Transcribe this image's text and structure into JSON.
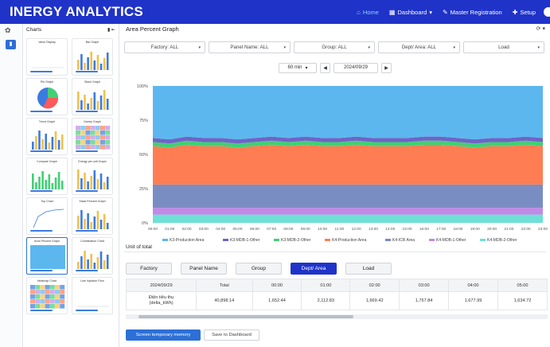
{
  "app": {
    "brand": "INERGY ANALYTICS",
    "nav": [
      {
        "label": "Home",
        "icon": "home-icon"
      },
      {
        "label": "Dashboard",
        "icon": "dashboard-icon"
      },
      {
        "label": "Master Registration",
        "icon": "edit-icon"
      },
      {
        "label": "Setup",
        "icon": "wrench-icon"
      }
    ]
  },
  "sidebar": {
    "title": "Charts",
    "thumbs": [
      {
        "title": "Value Display"
      },
      {
        "title": "Bar Graph"
      },
      {
        "title": "Pie Graph"
      },
      {
        "title": "Stack Graph"
      },
      {
        "title": "Trend Graph"
      },
      {
        "title": "Gantry Graph"
      },
      {
        "title": "Compare Graph"
      },
      {
        "title": "Energy per unit Graph"
      },
      {
        "title": "Top Chart"
      },
      {
        "title": "Stack Percent Graph"
      },
      {
        "title": "Area Percent Graph"
      },
      {
        "title": "Combination Chart"
      },
      {
        "title": "Heatmap Chart"
      },
      {
        "title": "Line Injection Flow"
      }
    ]
  },
  "main": {
    "title": "Area Percent Graph",
    "filters": [
      {
        "label": "Factory: ALL"
      },
      {
        "label": "Panel Name: ALL"
      },
      {
        "label": "Group: ALL"
      },
      {
        "label": "Dept/ Area: ALL"
      },
      {
        "label": "Load"
      }
    ],
    "interval": "60 min",
    "date": "2024/09/29",
    "unit_label": "Unit of total",
    "tabs": [
      "Factory",
      "Panel Name",
      "Group",
      "Dept/ Area",
      "Load"
    ],
    "active_tab": "Dept/ Area",
    "table": {
      "headers": [
        "2024/09/29",
        "Total",
        "00:00",
        "01:00",
        "02:00",
        "03:00",
        "04:00",
        "05:00"
      ],
      "row_label_line1": "Điện tiêu thụ",
      "row_label_line2": "(delta_kWh)",
      "values": [
        "40,898.14",
        "1,652.44",
        "2,112.83",
        "1,669.42",
        "1,767.84",
        "1,677.99",
        "1,634.72"
      ]
    },
    "buttons": {
      "primary": "Screen temporary memory",
      "secondary": "Save to Dashboard"
    }
  },
  "chart_data": {
    "type": "area",
    "stacked_percent": true,
    "x": [
      "00:00",
      "01:00",
      "02:00",
      "03:00",
      "04:00",
      "05:00",
      "06:00",
      "07:00",
      "08:00",
      "09:00",
      "10:00",
      "11:00",
      "12:00",
      "13:00",
      "14:00",
      "15:00",
      "16:00",
      "17:00",
      "18:00",
      "19:00",
      "20:00",
      "21:00",
      "22:00",
      "23:00"
    ],
    "ylim": [
      0,
      100
    ],
    "yticks": [
      "0%",
      "25%",
      "50%",
      "75%",
      "100%"
    ],
    "legend_position": "bottom",
    "grid": true,
    "series": [
      {
        "name": "K3-Production Area",
        "color": "#5cb7ef",
        "values": [
          38,
          39,
          37,
          38,
          38,
          39,
          38,
          37,
          38,
          37,
          38,
          38,
          37,
          38,
          38,
          38,
          37,
          37,
          38,
          39,
          38,
          38,
          37,
          38
        ]
      },
      {
        "name": "K3-MDB-1-Other",
        "color": "#6f64c6",
        "values": [
          3,
          3,
          3,
          3,
          3,
          3,
          3,
          3,
          3,
          3,
          3,
          3,
          3,
          3,
          3,
          3,
          3,
          3,
          3,
          3,
          3,
          3,
          3,
          3
        ]
      },
      {
        "name": "K3-MDB-2-Other",
        "color": "#42cf74",
        "values": [
          3,
          3,
          3,
          3,
          3,
          3,
          3,
          3,
          3,
          3,
          3,
          3,
          3,
          3,
          3,
          3,
          3,
          3,
          3,
          3,
          3,
          3,
          3,
          3
        ]
      },
      {
        "name": "K4-Production Area",
        "color": "#ff7d52",
        "values": [
          28,
          27,
          29,
          28,
          28,
          27,
          28,
          29,
          28,
          29,
          28,
          28,
          29,
          28,
          28,
          28,
          29,
          29,
          28,
          27,
          28,
          28,
          29,
          28
        ]
      },
      {
        "name": "K4-ICR Area",
        "color": "#7a8dc2",
        "values": [
          17,
          17,
          17,
          17,
          17,
          17,
          17,
          17,
          17,
          17,
          17,
          17,
          17,
          17,
          17,
          17,
          17,
          17,
          17,
          17,
          17,
          17,
          17,
          17
        ]
      },
      {
        "name": "K4-MDB-1-Other",
        "color": "#c08ae6",
        "values": [
          5,
          5,
          5,
          5,
          5,
          5,
          5,
          5,
          5,
          5,
          5,
          5,
          5,
          5,
          5,
          5,
          5,
          5,
          5,
          5,
          5,
          5,
          5,
          5
        ]
      },
      {
        "name": "K4-MDB-2-Other",
        "color": "#6ee0d6",
        "values": [
          6,
          6,
          6,
          6,
          6,
          6,
          6,
          6,
          6,
          6,
          6,
          6,
          6,
          6,
          6,
          6,
          6,
          6,
          6,
          6,
          6,
          6,
          6,
          6
        ]
      }
    ]
  }
}
